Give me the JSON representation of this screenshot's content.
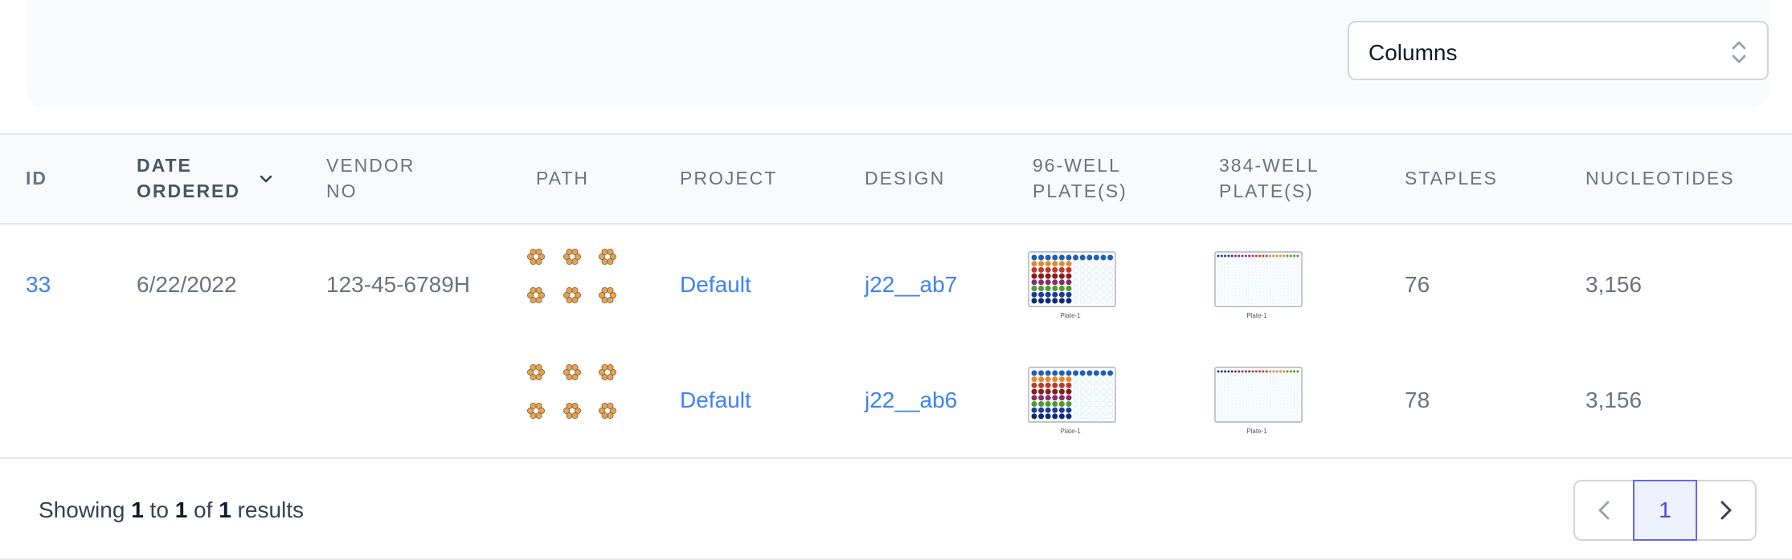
{
  "toolbar": {
    "columns_select": {
      "label": "Columns",
      "icon": "selector-icon"
    }
  },
  "table": {
    "headers": {
      "id": "ID",
      "date_line1": "DATE",
      "date_line2": "ORDERED",
      "vendor_line1": "VENDOR",
      "vendor_line2": "NO",
      "path": "PATH",
      "project": "PROJECT",
      "design": "DESIGN",
      "p96_line1": "96-WELL",
      "p96_line2": "PLATE(S)",
      "p384_line1": "384-WELL",
      "p384_line2": "PLATE(S)",
      "staples": "STAPLES",
      "nucleotides": "NUCLEOTIDES"
    },
    "rows": [
      {
        "id": "33",
        "date": "6/22/2022",
        "vendor": "123-45-6789H",
        "project": "Default",
        "design": "j22__ab7",
        "plate96_label": "Plate-1",
        "plate384_label": "Plate-1",
        "staples": "76",
        "nucleotides": "3,156"
      },
      {
        "project": "Default",
        "design": "j22__ab6",
        "plate96_label": "Plate-1",
        "plate384_label": "Plate-1",
        "staples": "78",
        "nucleotides": "3,156"
      }
    ]
  },
  "footer": {
    "showing_prefix": "Showing",
    "from": "1",
    "to_word": "to",
    "to": "1",
    "of_word": "of",
    "total": "1",
    "results_word": "results",
    "current_page": "1"
  },
  "colors": {
    "link": "#3b82f6",
    "header_bg": "#f9fafb",
    "active_page": "#6366f1"
  }
}
